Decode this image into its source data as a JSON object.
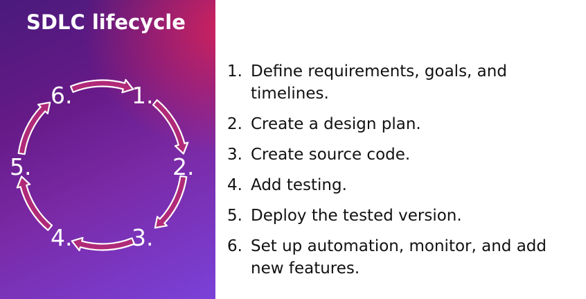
{
  "slide": {
    "title": "SDLC lifecycle",
    "colors": {
      "gradient_top": "#d6235a",
      "gradient_mid": "#651a87",
      "gradient_bottom": "#7a41d8",
      "arrow_fill": "#b02a78",
      "arrow_stroke": "#ffffff",
      "text_dark": "#111111"
    }
  },
  "cycle": {
    "labels": [
      "1.",
      "2.",
      "3.",
      "4.",
      "5.",
      "6."
    ]
  },
  "steps": [
    {
      "num": "1.",
      "text": "Define requirements, goals, and timelines."
    },
    {
      "num": "2.",
      "text": "Create a design plan."
    },
    {
      "num": "3.",
      "text": "Create source code."
    },
    {
      "num": "4.",
      "text": "Add testing."
    },
    {
      "num": "5.",
      "text": "Deploy the tested version."
    },
    {
      "num": "6.",
      "text": "Set up automation, monitor, and add new features."
    }
  ]
}
